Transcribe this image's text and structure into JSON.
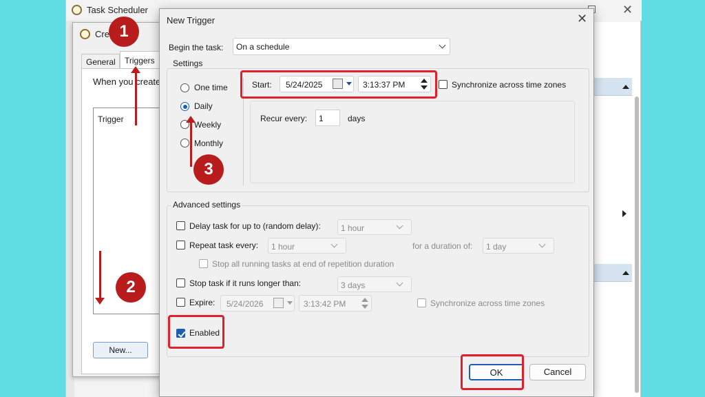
{
  "task_scheduler": {
    "title": "Task Scheduler",
    "close_glyph": "✕"
  },
  "create_task": {
    "title": "Cre",
    "tabs": [
      "General",
      "Triggers"
    ],
    "description": "When you create",
    "trigger_column": "Trigger",
    "new_button": "New..."
  },
  "new_trigger": {
    "title": "New Trigger",
    "close_glyph": "✕",
    "begin_label": "Begin the task:",
    "begin_value": "On a schedule",
    "settings": {
      "group_label": "Settings",
      "schedule_options": [
        "One time",
        "Daily",
        "Weekly",
        "Monthly"
      ],
      "selected_option": "Daily",
      "start_label": "Start:",
      "start_date": "5/24/2025",
      "start_time": "3:13:37 PM",
      "sync_time_zones": "Synchronize across time zones",
      "recur_label": "Recur every:",
      "recur_value": "1",
      "recur_unit": "days"
    },
    "advanced": {
      "group_label": "Advanced settings",
      "delay_label": "Delay task for up to (random delay):",
      "delay_value": "1 hour",
      "repeat_label": "Repeat task every:",
      "repeat_value": "1 hour",
      "duration_label": "for a duration of:",
      "duration_value": "1 day",
      "stop_all_label": "Stop all running tasks at end of repetition duration",
      "stop_if_label": "Stop task if it runs longer than:",
      "stop_if_value": "3 days",
      "expire_label": "Expire:",
      "expire_date": "5/24/2026",
      "expire_time": "3:13:42 PM",
      "expire_sync_label": "Synchronize across time zones",
      "enabled_label": "Enabled",
      "enabled_checked": true
    },
    "buttons": {
      "ok": "OK",
      "cancel": "Cancel"
    }
  },
  "annotations": {
    "step_1": "1",
    "step_2": "2",
    "step_3": "3",
    "highlight_color": "#e0202a",
    "badge_color": "#b91c1c"
  },
  "colors": {
    "background": "#5fdde3",
    "accent": "#1a5fb4"
  }
}
